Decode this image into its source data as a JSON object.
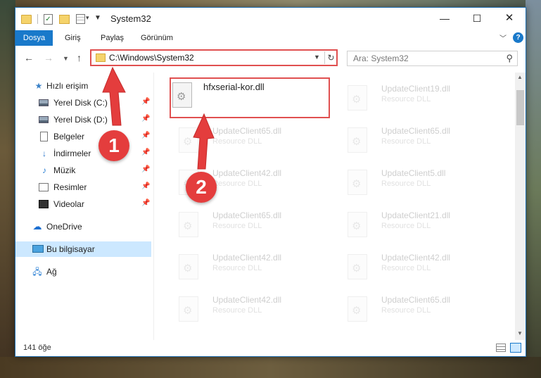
{
  "window": {
    "title": "System32",
    "controls": {
      "minimize": "—",
      "maximize": "☐",
      "close": "✕"
    }
  },
  "ribbon": {
    "tabs": [
      "Dosya",
      "Giriş",
      "Paylaş",
      "Görünüm"
    ],
    "help": "?"
  },
  "navigation": {
    "address": "C:\\Windows\\System32",
    "search_placeholder": "Ara: System32"
  },
  "sidebar": {
    "quick_access": "Hızlı erişim",
    "items": [
      "Yerel Disk (C:)",
      "Yerel Disk (D:)",
      "Belgeler",
      "İndirmeler",
      "Müzik",
      "Resimler",
      "Videolar"
    ],
    "onedrive": "OneDrive",
    "this_pc": "Bu bilgisayar",
    "network": "Ağ"
  },
  "files": {
    "highlighted": {
      "name": "hfxserial-kor.dll"
    },
    "faded": [
      {
        "name": "UpdateClient19.dll",
        "type": "Resource DLL"
      },
      {
        "name": "UpdateClient65.dll",
        "type": "Resource DLL"
      },
      {
        "name": "UpdateClient65.dll",
        "type": "Resource DLL"
      },
      {
        "name": "UpdateClient42.dll",
        "type": "Resource DLL"
      },
      {
        "name": "UpdateClient5.dll",
        "type": "Resource DLL"
      },
      {
        "name": "UpdateClient65.dll",
        "type": "Resource DLL"
      },
      {
        "name": "UpdateClient21.dll",
        "type": "Resource DLL"
      },
      {
        "name": "UpdateClient42.dll",
        "type": "Resource DLL"
      },
      {
        "name": "UpdateClient42.dll",
        "type": "Resource DLL"
      },
      {
        "name": "UpdateClient42.dll",
        "type": "Resource DLL"
      },
      {
        "name": "UpdateClient65.dll",
        "type": "Resource DLL"
      }
    ]
  },
  "status": {
    "count": "141 öğe"
  },
  "callouts": {
    "one": "1",
    "two": "2"
  },
  "colors": {
    "accent": "#1979ca",
    "callout": "#e43d3d",
    "selection": "#cce8ff"
  }
}
